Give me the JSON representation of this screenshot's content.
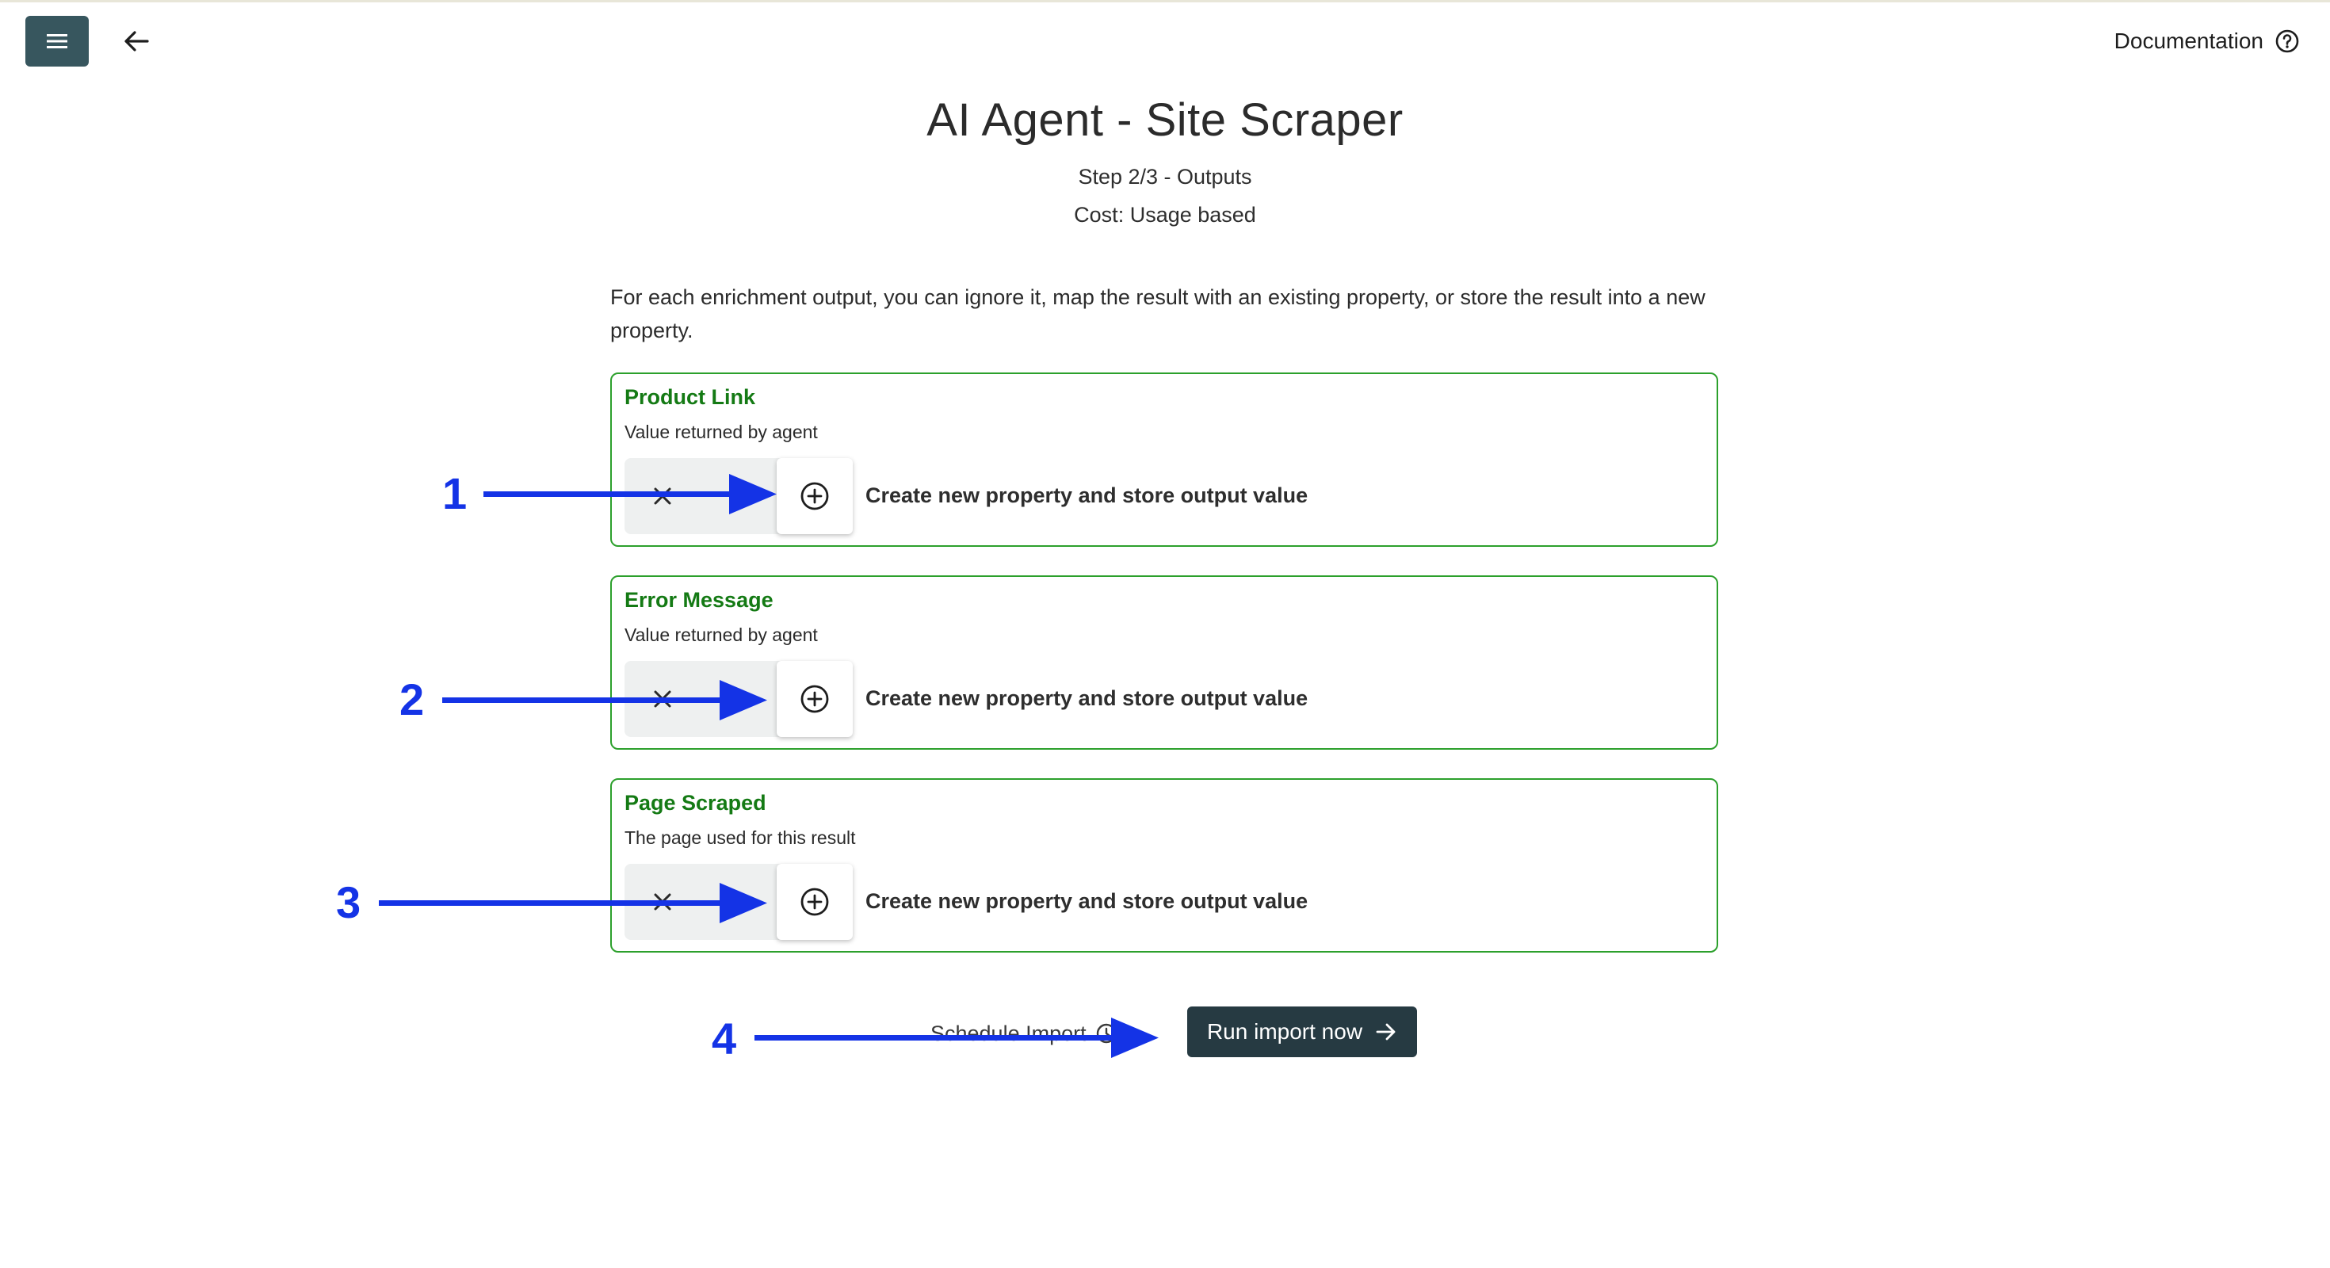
{
  "header": {
    "menu_icon": "hamburger-menu-icon",
    "back_icon": "arrow-left-icon",
    "documentation_label": "Documentation",
    "help_icon": "help-circle-icon"
  },
  "page": {
    "title": "AI Agent - Site Scraper",
    "step": "Step 2/3 - Outputs",
    "cost": "Cost: Usage based",
    "intro": "For each enrichment output, you can ignore it, map the result with an existing property, or store the result into a new property."
  },
  "outputs": [
    {
      "title": "Product Link",
      "description": "Value returned by agent",
      "action": "Create new property and store output value",
      "selected_option": "create-new"
    },
    {
      "title": "Error Message",
      "description": "Value returned by agent",
      "action": "Create new property and store output value",
      "selected_option": "create-new"
    },
    {
      "title": "Page Scraped",
      "description": "The page used for this result",
      "action": "Create new property and store output value",
      "selected_option": "create-new"
    }
  ],
  "footer": {
    "schedule_label": "Schedule Import",
    "run_label": "Run import now"
  },
  "annotations": [
    "1",
    "2",
    "3",
    "4"
  ],
  "colors": {
    "accent_green": "#147a14",
    "card_border": "#2ca02c",
    "primary_button": "#263a42",
    "menu_button": "#37565e",
    "annotation_blue": "#1433e6"
  }
}
